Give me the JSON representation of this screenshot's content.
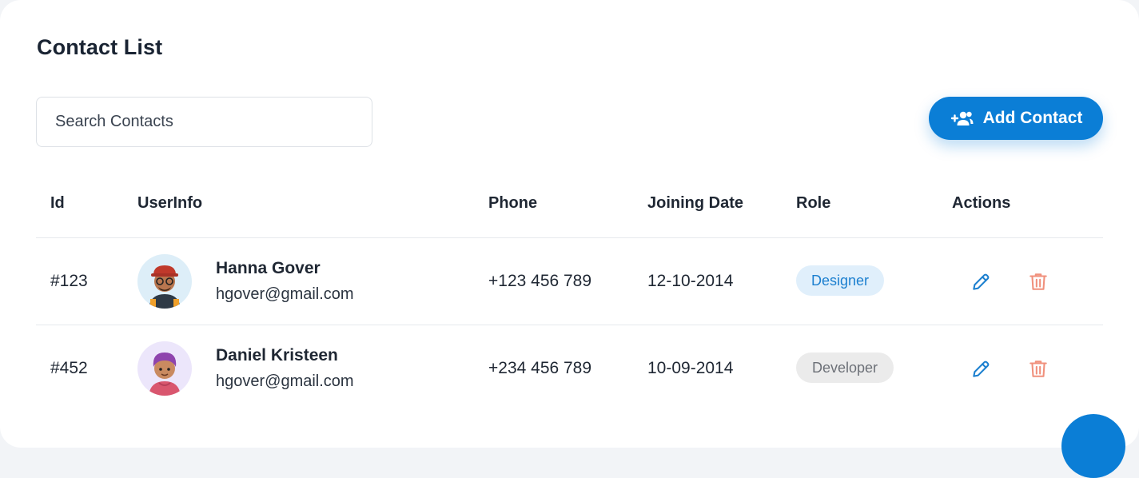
{
  "header": {
    "title": "Contact List"
  },
  "search": {
    "placeholder": "Search Contacts"
  },
  "toolbar": {
    "add_label": "Add Contact",
    "add_icon": "user-plus-icon"
  },
  "table": {
    "columns": [
      "Id",
      "UserInfo",
      "Phone",
      "Joining Date",
      "Role",
      "Actions"
    ],
    "rows": [
      {
        "id": "#123",
        "name": "Hanna Gover",
        "email": "hgover@gmail.com",
        "phone": "+123 456 789",
        "date": "12-10-2014",
        "role": "Designer"
      },
      {
        "id": "#452",
        "name": "Daniel Kristeen",
        "email": "hgover@gmail.com",
        "phone": "+234 456 789",
        "date": "10-09-2014",
        "role": "Developer"
      }
    ]
  },
  "colors": {
    "accent": "#0b7ed6",
    "edit_icon": "#1b7fcf",
    "delete_icon": "#f0907c",
    "designer_badge_bg": "#e0effb",
    "developer_badge_bg": "#ebebeb"
  }
}
